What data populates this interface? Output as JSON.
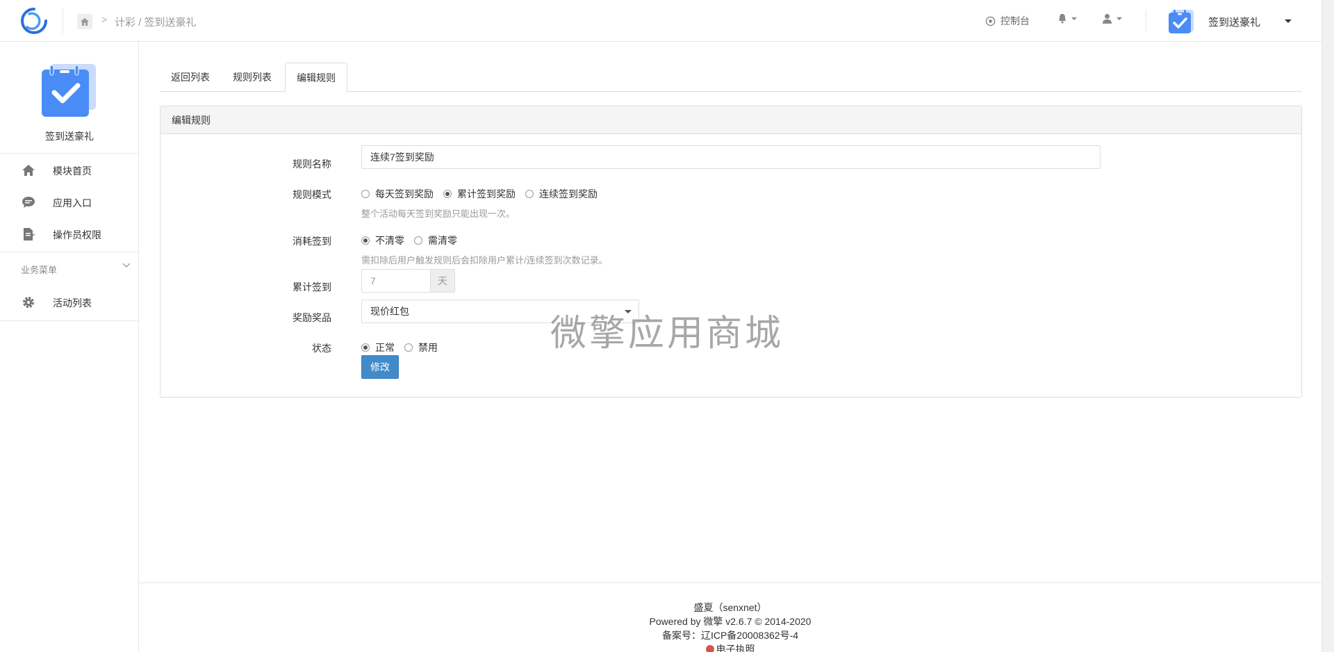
{
  "header": {
    "breadcrumb_sep": ">",
    "breadcrumb_parent": "计彩",
    "breadcrumb_slash": "/",
    "breadcrumb_current": "签到送豪礼",
    "console_label": "控制台",
    "app_name": "签到送豪礼"
  },
  "sidebar": {
    "app_name": "签到送豪礼",
    "items": [
      {
        "label": "模块首页",
        "icon": "home-icon"
      },
      {
        "label": "应用入口",
        "icon": "chat-icon"
      },
      {
        "label": "操作员权限",
        "icon": "document-edit-icon"
      }
    ],
    "group_title": "业务菜单",
    "group_items": [
      {
        "label": "活动列表",
        "icon": "gear-icon"
      }
    ]
  },
  "tabs": [
    {
      "label": "返回列表",
      "active": false
    },
    {
      "label": "规则列表",
      "active": false
    },
    {
      "label": "编辑规则",
      "active": true
    }
  ],
  "form": {
    "panel_title": "编辑规则",
    "rule_name_label": "规则名称",
    "rule_name_value": "连续7签到奖励",
    "rule_mode_label": "规则模式",
    "rule_mode_options": [
      "每天签到奖励",
      "累计签到奖励",
      "连续签到奖励"
    ],
    "rule_mode_selected": 1,
    "rule_mode_help": "整个活动每天签到奖励只能出现一次。",
    "consume_label": "消耗签到",
    "consume_options": [
      "不清零",
      "需清零"
    ],
    "consume_selected": 0,
    "consume_help": "需扣除后用户触发规则后会扣除用户累计/连续签到次数记录。",
    "cumulative_label": "累计签到",
    "cumulative_value": "7",
    "cumulative_unit": "天",
    "reward_label": "奖励奖品",
    "reward_value": "现价红包",
    "status_label": "状态",
    "status_options": [
      "正常",
      "禁用"
    ],
    "status_selected": 0,
    "submit_label": "修改"
  },
  "watermark": "微擎应用商城",
  "footer": {
    "line1": "盛夏（senxnet）",
    "line2": "Powered by 微擎 v2.6.7 © 2014-2020",
    "line3": "备案号：辽ICP备20008362号-4",
    "line4": "电子执照"
  },
  "colors": {
    "primary": "#428bca",
    "logo_blue": "#2a6fdb",
    "app_icon_blue": "#4a8cf5"
  }
}
